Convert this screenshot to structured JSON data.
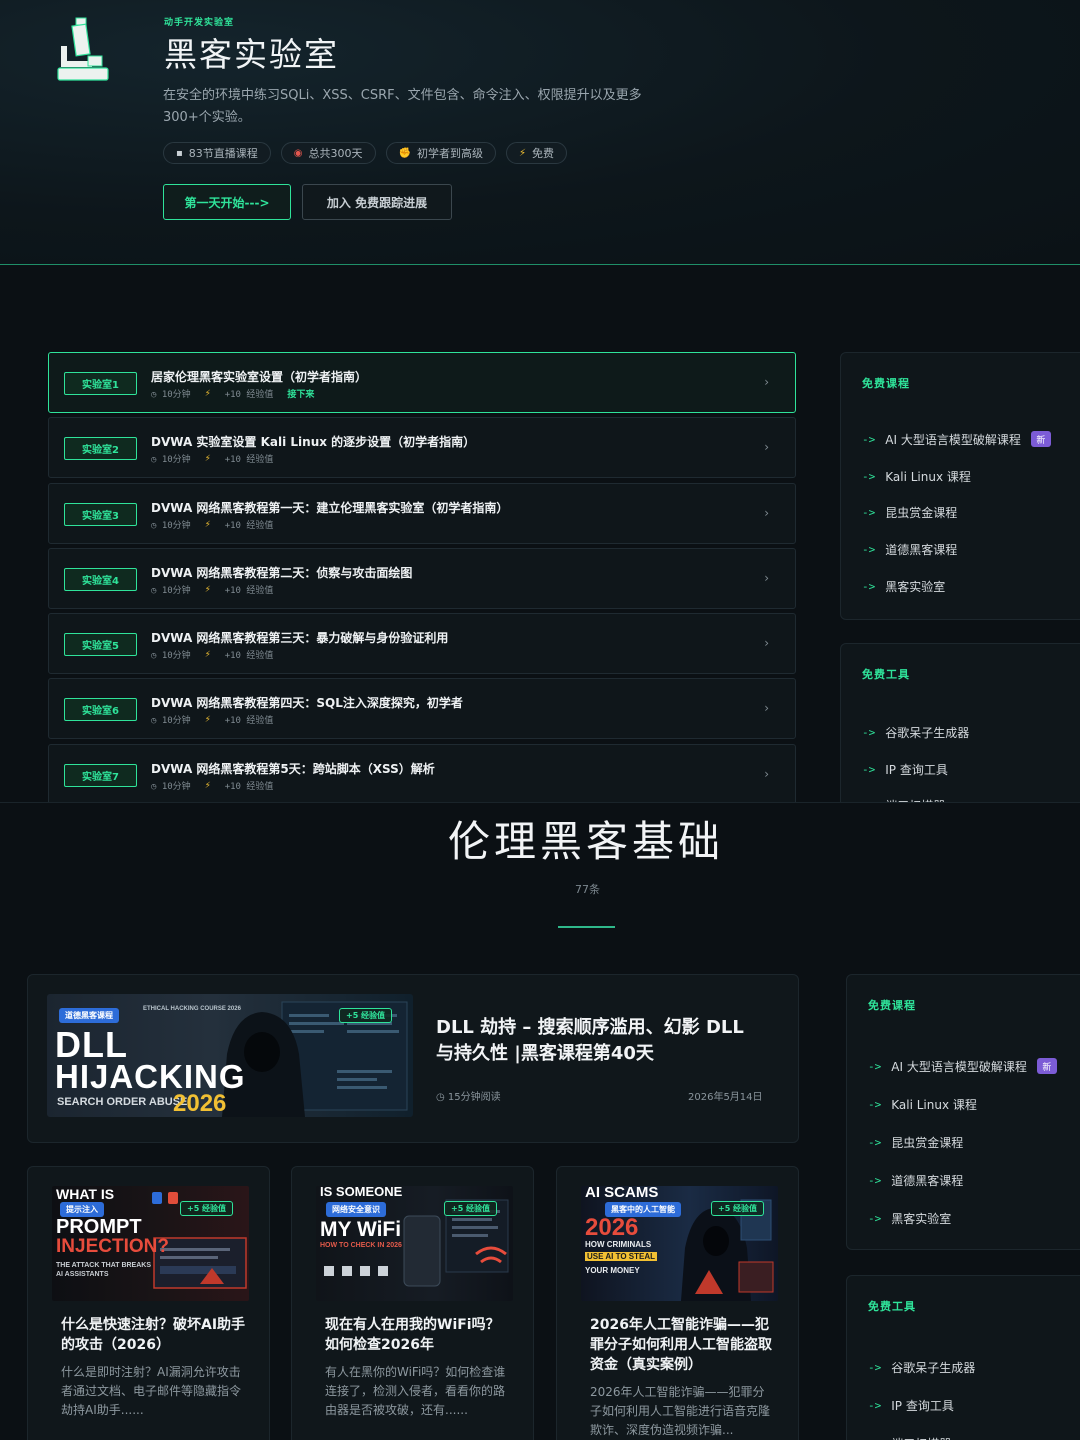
{
  "hero": {
    "kicker": "动手开发实验室",
    "title": "黑客实验室",
    "description": "在安全的环境中练习SQLi、XSS、CSRF、文件包含、命令注入、权限提升以及更多300+个实验。",
    "tags": [
      {
        "icon": "book-icon",
        "glyph": "▪",
        "label": "83节直播课程"
      },
      {
        "icon": "target-icon",
        "glyph": "◉",
        "label": "总共300天"
      },
      {
        "icon": "flex-arm-icon",
        "glyph": "✊",
        "label": "初学者到高级"
      },
      {
        "icon": "bolt-icon",
        "glyph": "⚡",
        "label": "免费"
      }
    ],
    "primary_button": "第一天开始--->",
    "secondary_button": "加入 免费跟踪进展"
  },
  "labs": {
    "meta_time": "10分钟",
    "meta_xp": "+10 经验值",
    "next_label": "接下来",
    "items": [
      {
        "badge": "实验室1",
        "title": "居家伦理黑客实验室设置（初学者指南）",
        "active": true
      },
      {
        "badge": "实验室2",
        "title": "DVWA 实验室设置 Kali Linux 的逐步设置（初学者指南）",
        "active": false
      },
      {
        "badge": "实验室3",
        "title": "DVWA 网络黑客教程第一天：建立伦理黑客实验室（初学者指南）",
        "active": false
      },
      {
        "badge": "实验室4",
        "title": "DVWA 网络黑客教程第二天：侦察与攻击面绘图",
        "active": false
      },
      {
        "badge": "实验室5",
        "title": "DVWA 网络黑客教程第三天：暴力破解与身份验证利用",
        "active": false
      },
      {
        "badge": "实验室6",
        "title": "DVWA 网络黑客教程第四天：SQL注入深度探究，初学者",
        "active": false
      },
      {
        "badge": "实验室7",
        "title": "DVWA 网络黑客教程第5天：跨站脚本（XSS）解析",
        "active": false
      }
    ]
  },
  "sidebar": {
    "courses_heading": "免费课程",
    "tools_heading": "免费工具",
    "arrow": "->",
    "new_badge": "新",
    "courses": [
      {
        "label": "AI 大型语言模型破解课程",
        "is_new": true
      },
      {
        "label": "Kali Linux 课程",
        "is_new": false
      },
      {
        "label": "昆虫赏金课程",
        "is_new": false
      },
      {
        "label": "道德黑客课程",
        "is_new": false
      },
      {
        "label": "黑客实验室",
        "is_new": false
      }
    ],
    "tools": [
      {
        "label": "谷歌呆子生成器"
      },
      {
        "label": "IP 查询工具"
      },
      {
        "label": "端口扫描器"
      }
    ]
  },
  "section": {
    "title": "伦理黑客基础",
    "count": "77条"
  },
  "featured": {
    "thumb": {
      "tag": "道德黑客课程",
      "xp": "+5 经验值",
      "line1": "DLL",
      "line2": "HIJACKING",
      "line3": "SEARCH ORDER ABUSE",
      "year": "2026",
      "course": "ETHICAL HACKING COURSE 2026"
    },
    "title": "DLL 劫持 – 搜索顺序滥用、幻影 DLL 与持久性 |黑客课程第40天",
    "read_time": "15分钟阅读",
    "date": "2026年5月14日"
  },
  "cards": [
    {
      "thumb": {
        "tag": "提示注入",
        "xp": "+5 经验值",
        "line1": "WHAT IS",
        "line2": "PROMPT",
        "line3": "INJECTION?",
        "line4": "THE ATTACK THAT BREAKS AI ASSISTANTS"
      },
      "title": "什么是快速注射？破坏AI助手的攻击（2026）",
      "desc": "什么是即时注射？AI漏洞允许攻击者通过文档、电子邮件等隐藏指令劫持AI助手......"
    },
    {
      "thumb": {
        "tag": "网络安全意识",
        "xp": "+5 经验值",
        "line1": "IS SOMEONE",
        "line2": "MY WiFi",
        "line3": "HOW TO CHECK IN 2026"
      },
      "title": "现在有人在用我的WiFi吗？如何检查2026年",
      "desc": "有人在黑你的WiFi吗？如何检查谁连接了，检测入侵者，看看你的路由器是否被攻破，还有......"
    },
    {
      "thumb": {
        "tag": "黑客中的人工智能",
        "xp": "+5 经验值",
        "line1": "AI SCAMS",
        "line2": "2026",
        "line3": "HOW CRIMINALS",
        "line4": "USE AI TO STEAL",
        "line5": "YOUR MONEY"
      },
      "title": "2026年人工智能诈骗——犯罪分子如何利用人工智能盗取资金（真实案例）",
      "desc": "2026年人工智能诈骗——犯罪分子如何利用人工智能进行语音克隆欺诈、深度伪造视频诈骗..."
    }
  ],
  "colors": {
    "accent": "#2fe39a",
    "background": "#0b1014",
    "panel": "#0f161a",
    "new_badge": "#7c5cd6",
    "bolt": "#f2c033"
  }
}
